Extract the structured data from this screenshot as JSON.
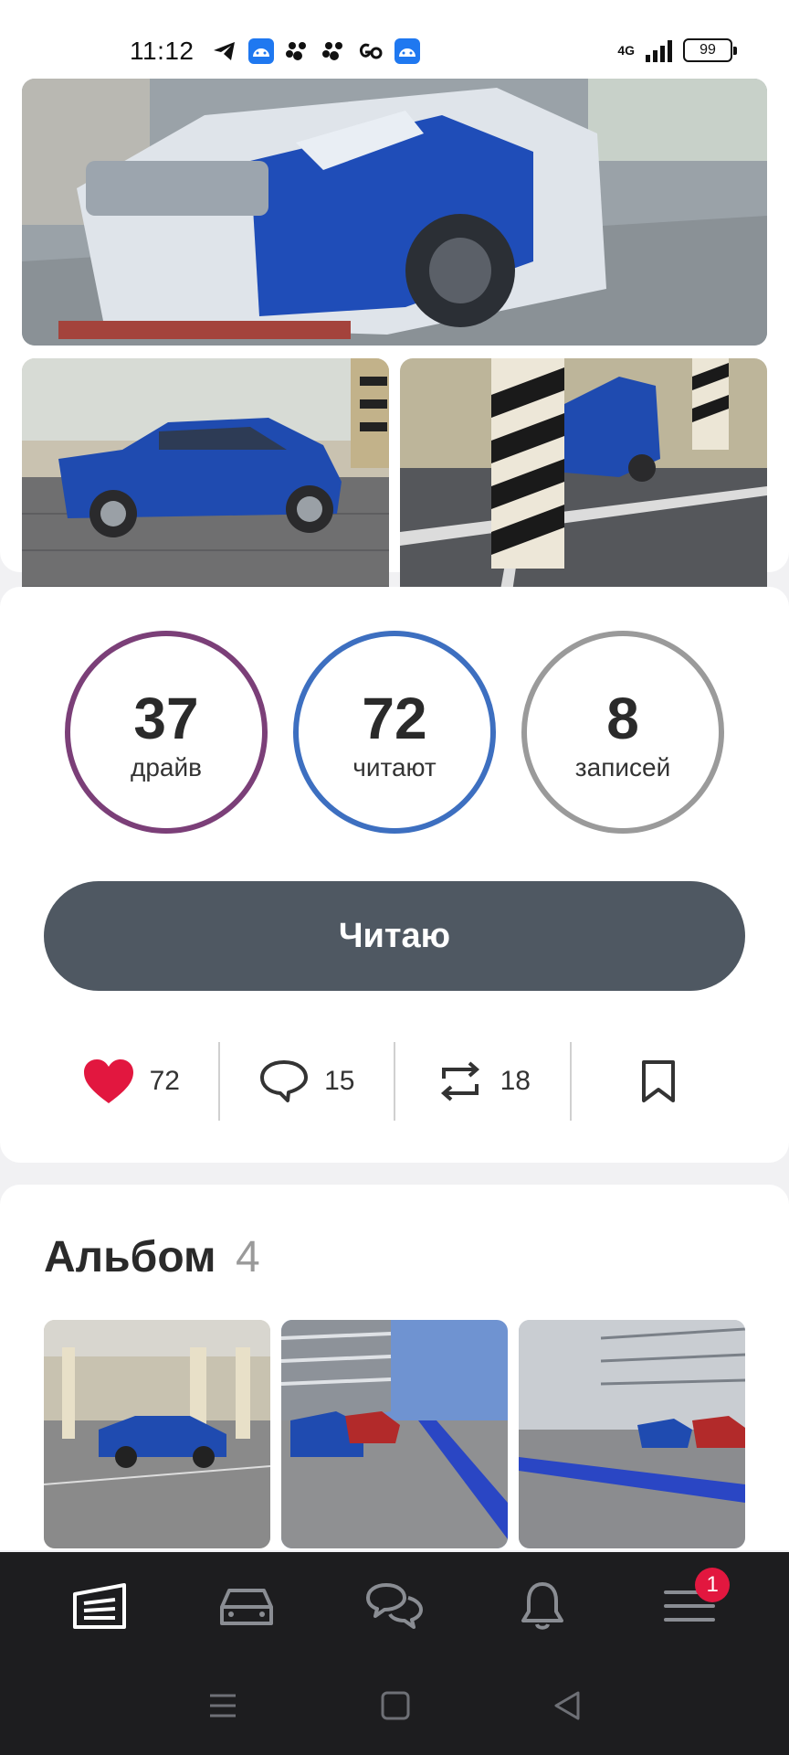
{
  "status_bar": {
    "time": "11:12",
    "network": "4G",
    "battery": "99"
  },
  "stats": {
    "drive": {
      "value": "37",
      "label": "драйв"
    },
    "readers": {
      "value": "72",
      "label": "читают"
    },
    "posts": {
      "value": "8",
      "label": "записей"
    }
  },
  "follow_button_label": "Читаю",
  "actions": {
    "likes": "72",
    "comments": "15",
    "reposts": "18"
  },
  "album": {
    "title": "Альбом",
    "count": "4"
  },
  "tabbar": {
    "notifications_badge": "1"
  },
  "colors": {
    "drive_ring": "#7b3f78",
    "readers_ring": "#3d6fc0",
    "posts_ring": "#9a9a9a",
    "button": "#4f5862",
    "like": "#e2173f"
  }
}
